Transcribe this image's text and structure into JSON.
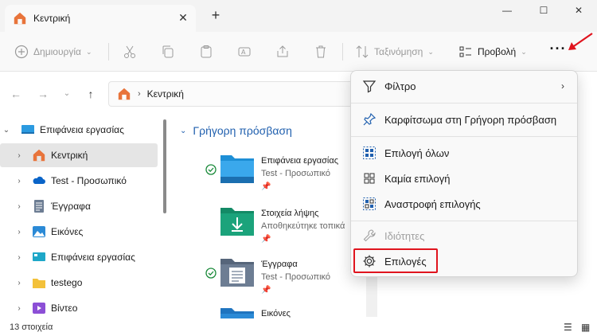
{
  "tab": {
    "title": "Κεντρική",
    "close": "✕",
    "new": "+"
  },
  "window": {
    "minimize": "—",
    "maximize": "☐",
    "close": "✕"
  },
  "commands": {
    "new_label": "Δημιουργία",
    "sort_label": "Ταξινόμηση",
    "view_label": "Προβολή",
    "more": "···"
  },
  "address": {
    "path": "Κεντρική"
  },
  "sidebar": {
    "items": [
      {
        "label": "Επιφάνεια εργασίας",
        "expanded": true
      },
      {
        "label": "Κεντρική",
        "selected": true
      },
      {
        "label": "Test - Προσωπικό"
      },
      {
        "label": "Έγγραφα"
      },
      {
        "label": "Εικόνες"
      },
      {
        "label": "Επιφάνεια εργασίας"
      },
      {
        "label": "testego"
      },
      {
        "label": "Βίντεο"
      }
    ]
  },
  "main": {
    "section_title": "Γρήγορη πρόσβαση",
    "items": [
      {
        "name": "Επιφάνεια εργασίας",
        "sub": "Test - Προσωπικό",
        "color": "#1e8fd6"
      },
      {
        "name": "Στοιχεία λήψης",
        "sub": "Αποθηκεύτηκε τοπικά",
        "color": "#1ba37b"
      },
      {
        "name": "Έγγραφα",
        "sub": "Test - Προσωπικό",
        "color": "#6d7d93"
      },
      {
        "name": "Εικόνες",
        "sub": "",
        "color": "#2b8ad6"
      }
    ]
  },
  "status": {
    "count": "13 στοιχεία"
  },
  "menu": {
    "filter": "Φίλτρο",
    "pin": "Καρφίτσωμα στη Γρήγορη πρόσβαση",
    "select_all": "Επιλογή όλων",
    "select_none": "Καμία επιλογή",
    "invert": "Αναστροφή επιλογής",
    "properties": "Ιδιότητες",
    "options": "Επιλογές"
  },
  "colors": {
    "accent": "#1f5fae",
    "highlight": "#e0141e"
  }
}
